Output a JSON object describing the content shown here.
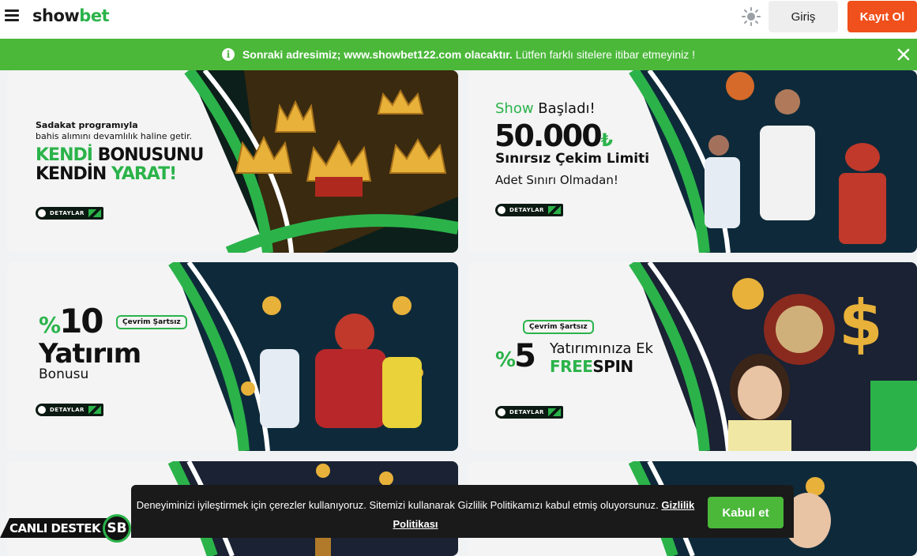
{
  "header": {
    "logo_part1": "show",
    "logo_part2": "bet",
    "login_label": "Giriş",
    "register_label": "Kayıt Ol",
    "icons": {
      "menu": "hamburger-icon",
      "theme": "sun-icon"
    }
  },
  "notice": {
    "strong_text": "Sonraki adresimiz; www.showbet122.com olacaktır.",
    "text": "Lütfen farklı sitelere itibar etmeyiniz !",
    "icons": {
      "info": "info-icon",
      "close": "close-icon"
    }
  },
  "promos": [
    {
      "line1": "Sadakat programıyla",
      "line2": "bahis alımını devamlılık haline getir.",
      "title1_a": "KENDİ",
      "title1_b": " BONUSUNU",
      "title2_a": "KENDİN ",
      "title2_b": "YARAT!",
      "details": "DETAYLAR"
    },
    {
      "pre_a": "Show",
      "pre_b": " Başladı!",
      "amount": "50.000",
      "currency": "₺",
      "subtitle": "Sınırsız Çekim Limiti",
      "note": "Adet Sınırı Olmadan!",
      "details": "DETAYLAR"
    },
    {
      "percent_sign": "%",
      "amount": "10",
      "tag": "Çevrim Şartsız",
      "title": "Yatırım",
      "subtitle": "Bonusu",
      "details": "DETAYLAR"
    },
    {
      "tag": "Çevrim Şartsız",
      "percent_sign": "%",
      "amount": "5",
      "line1": "Yatırımınıza Ek",
      "line2_a": "FREE",
      "line2_b": "SPIN",
      "details": "DETAYLAR"
    }
  ],
  "cookie": {
    "message": "Deneyiminizi iyileştirmek için çerezler kullanıyoruz. Sitemizi kullanarak Gizlilik Politikamızı kabul etmiş oluyorsunuz.",
    "link": "Gizlilik Politikası",
    "accept": "Kabul et"
  },
  "support": {
    "label": "CANLI DESTEK",
    "badge": "SB"
  },
  "colors": {
    "brand_green": "#2bb34a",
    "notice_green": "#4bb83a",
    "register_orange": "#f0501b",
    "dark": "#111111"
  }
}
